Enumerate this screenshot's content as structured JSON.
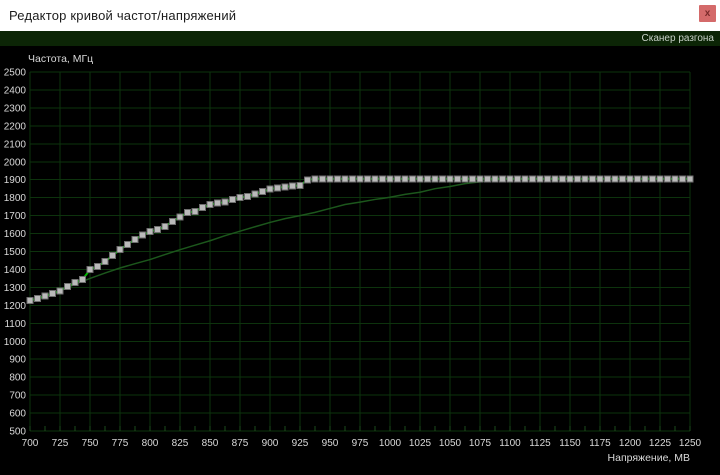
{
  "window": {
    "title": "Редактор кривой частот/напряжений",
    "close_glyph": "x"
  },
  "header": {
    "scanner_label": "Сканер разгона"
  },
  "chart_data": {
    "type": "line",
    "title": "",
    "xlabel": "Напряжение, МВ",
    "ylabel": "Частота, МГц",
    "xlim": [
      700,
      1250
    ],
    "ylim": [
      500,
      2500
    ],
    "x_ticks": [
      700,
      725,
      750,
      775,
      800,
      825,
      850,
      875,
      900,
      925,
      950,
      975,
      1000,
      1025,
      1050,
      1075,
      1100,
      1125,
      1150,
      1175,
      1200,
      1225,
      1250
    ],
    "y_ticks": [
      2500,
      2400,
      2300,
      2200,
      2100,
      2000,
      1900,
      1800,
      1700,
      1600,
      1500,
      1400,
      1300,
      1200,
      1100,
      1000,
      900,
      800,
      700,
      600,
      500
    ],
    "x_minor_step": 12.5,
    "grid": true,
    "legend": "none",
    "colors": {
      "plot_bg": "#000000",
      "grid": "#0d330d",
      "minor_tick": "#1d4d1d",
      "text": "#d9d9d9",
      "curve": "#00b800",
      "marker_fill": "#bababa",
      "marker_stroke": "#6f6f6f",
      "default_line": "#1c571c"
    },
    "series": [
      {
        "name": "default-vf-curve",
        "style": "line",
        "points": [
          [
            700,
            1225
          ],
          [
            712.5,
            1245
          ],
          [
            725,
            1280
          ],
          [
            737.5,
            1317
          ],
          [
            750,
            1350
          ],
          [
            762.5,
            1380
          ],
          [
            775,
            1408
          ],
          [
            787.5,
            1432
          ],
          [
            800,
            1455
          ],
          [
            812.5,
            1483
          ],
          [
            825,
            1510
          ],
          [
            837.5,
            1535
          ],
          [
            850,
            1560
          ],
          [
            862.5,
            1588
          ],
          [
            875,
            1613
          ],
          [
            887.5,
            1638
          ],
          [
            900,
            1662
          ],
          [
            912.5,
            1683
          ],
          [
            925,
            1700
          ],
          [
            937.5,
            1718
          ],
          [
            950,
            1740
          ],
          [
            962.5,
            1762
          ],
          [
            975,
            1775
          ],
          [
            987.5,
            1790
          ],
          [
            1000,
            1802
          ],
          [
            1012.5,
            1818
          ],
          [
            1025,
            1830
          ],
          [
            1037.5,
            1850
          ],
          [
            1050,
            1862
          ],
          [
            1062.5,
            1878
          ],
          [
            1075,
            1888
          ],
          [
            1087.5,
            1900
          ],
          [
            1100,
            1905
          ],
          [
            1250,
            1905
          ]
        ]
      },
      {
        "name": "vf-curve-editable-points",
        "style": "line-markers",
        "points": [
          [
            700,
            1227
          ],
          [
            706.25,
            1239
          ],
          [
            712.5,
            1252
          ],
          [
            718.75,
            1266
          ],
          [
            725,
            1281
          ],
          [
            731.25,
            1304
          ],
          [
            737.5,
            1326
          ],
          [
            743.75,
            1344
          ],
          [
            750,
            1399
          ],
          [
            756.25,
            1417
          ],
          [
            762.5,
            1444
          ],
          [
            768.75,
            1477
          ],
          [
            775,
            1510
          ],
          [
            781.25,
            1540
          ],
          [
            787.5,
            1566
          ],
          [
            793.75,
            1591
          ],
          [
            800,
            1611
          ],
          [
            806.25,
            1622
          ],
          [
            812.5,
            1640
          ],
          [
            818.75,
            1667
          ],
          [
            825,
            1693
          ],
          [
            831.25,
            1716
          ],
          [
            837.5,
            1724
          ],
          [
            843.75,
            1745
          ],
          [
            850,
            1762
          ],
          [
            856.25,
            1769
          ],
          [
            862.5,
            1776
          ],
          [
            868.75,
            1789
          ],
          [
            875,
            1801
          ],
          [
            881.25,
            1806
          ],
          [
            887.5,
            1821
          ],
          [
            893.75,
            1834
          ],
          [
            900,
            1847
          ],
          [
            906.25,
            1855
          ],
          [
            912.5,
            1860
          ],
          [
            918.75,
            1864
          ],
          [
            925,
            1869
          ],
          [
            931.25,
            1899
          ],
          [
            937.5,
            1905
          ]
        ],
        "flat": {
          "from": 943.75,
          "to": 1250,
          "step": 6.25,
          "value": 1905
        }
      }
    ]
  }
}
